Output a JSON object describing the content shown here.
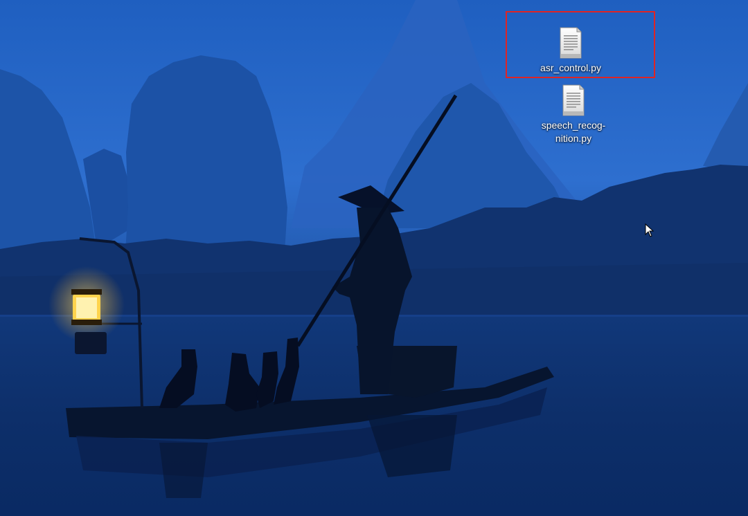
{
  "desktop": {
    "wallpaper_icon": "misty-karst-river-fisherman-photo",
    "selection_color": "#e02424",
    "icons": [
      {
        "label": "asr_control.py",
        "icon": "text-file-icon",
        "selected": true
      },
      {
        "label": "speech_recog-\nnition.py",
        "icon": "text-file-icon",
        "selected": false
      }
    ],
    "cursor": "arrow-cursor-icon"
  }
}
